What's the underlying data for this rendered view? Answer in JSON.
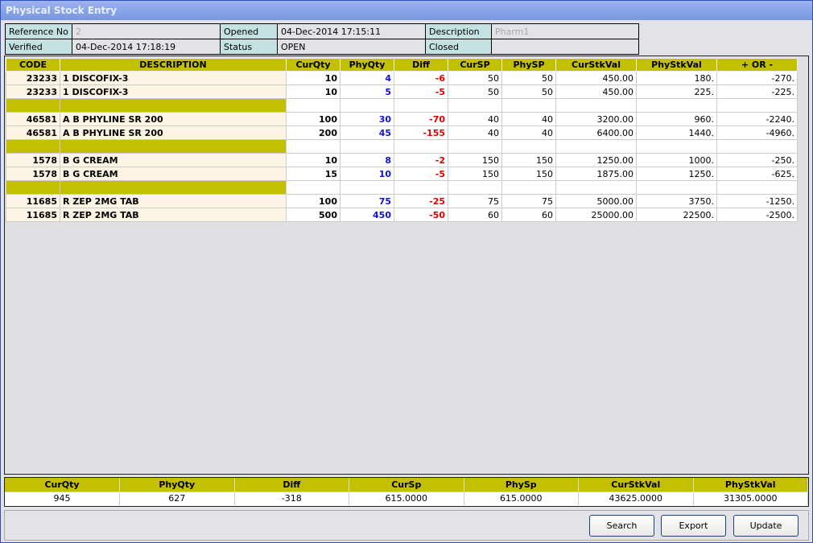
{
  "window": {
    "title": "Physical Stock Entry"
  },
  "info": {
    "reference_label": "Reference No",
    "reference_value": "2",
    "opened_label": "Opened",
    "opened_value": "04-Dec-2014 17:15:11",
    "description_label": "Description",
    "description_value": "Pharm1",
    "verified_label": "Verified",
    "verified_value": "04-Dec-2014 17:18:19",
    "status_label": "Status",
    "status_value": "OPEN",
    "closed_label": "Closed",
    "closed_value": ""
  },
  "grid": {
    "columns": [
      "CODE",
      "DESCRIPTION",
      "CurQty",
      "PhyQty",
      "Diff",
      "CurSP",
      "PhySP",
      "CurStkVal",
      "PhyStkVal",
      "+ OR -"
    ],
    "rows": [
      {
        "type": "data",
        "code": "23233",
        "desc": "1 DISCOFIX-3",
        "curqty": "10",
        "phyqty": "4",
        "diff": "-6",
        "cursp": "50",
        "physp": "50",
        "curstk": "450.00",
        "phystk": "180.",
        "pm": "-270."
      },
      {
        "type": "data",
        "code": "23233",
        "desc": "1 DISCOFIX-3",
        "curqty": "10",
        "phyqty": "5",
        "diff": "-5",
        "cursp": "50",
        "physp": "50",
        "curstk": "450.00",
        "phystk": "225.",
        "pm": "-225."
      },
      {
        "type": "group"
      },
      {
        "type": "data",
        "code": "46581",
        "desc": "A B PHYLINE SR 200",
        "curqty": "100",
        "phyqty": "30",
        "diff": "-70",
        "cursp": "40",
        "physp": "40",
        "curstk": "3200.00",
        "phystk": "960.",
        "pm": "-2240."
      },
      {
        "type": "data",
        "code": "46581",
        "desc": "A B PHYLINE SR 200",
        "curqty": "200",
        "phyqty": "45",
        "diff": "-155",
        "cursp": "40",
        "physp": "40",
        "curstk": "6400.00",
        "phystk": "1440.",
        "pm": "-4960."
      },
      {
        "type": "group"
      },
      {
        "type": "data",
        "code": "1578",
        "desc": "B G CREAM",
        "curqty": "10",
        "phyqty": "8",
        "diff": "-2",
        "cursp": "150",
        "physp": "150",
        "curstk": "1250.00",
        "phystk": "1000.",
        "pm": "-250."
      },
      {
        "type": "data",
        "code": "1578",
        "desc": "B G CREAM",
        "curqty": "15",
        "phyqty": "10",
        "diff": "-5",
        "cursp": "150",
        "physp": "150",
        "curstk": "1875.00",
        "phystk": "1250.",
        "pm": "-625."
      },
      {
        "type": "group"
      },
      {
        "type": "data",
        "code": "11685",
        "desc": "R ZEP 2MG TAB",
        "curqty": "100",
        "phyqty": "75",
        "diff": "-25",
        "cursp": "75",
        "physp": "75",
        "curstk": "5000.00",
        "phystk": "3750.",
        "pm": "-1250."
      },
      {
        "type": "data",
        "code": "11685",
        "desc": "R ZEP 2MG TAB",
        "curqty": "500",
        "phyqty": "450",
        "diff": "-50",
        "cursp": "60",
        "physp": "60",
        "curstk": "25000.00",
        "phystk": "22500.",
        "pm": "-2500."
      }
    ]
  },
  "summary": {
    "headers": [
      "CurQty",
      "PhyQty",
      "Diff",
      "CurSp",
      "PhySp",
      "CurStkVal",
      "PhyStkVal"
    ],
    "values": [
      "945",
      "627",
      "-318",
      "615.0000",
      "615.0000",
      "43625.0000",
      "31305.0000"
    ]
  },
  "buttons": {
    "search": "Search",
    "export": "Export",
    "update": "Update"
  }
}
